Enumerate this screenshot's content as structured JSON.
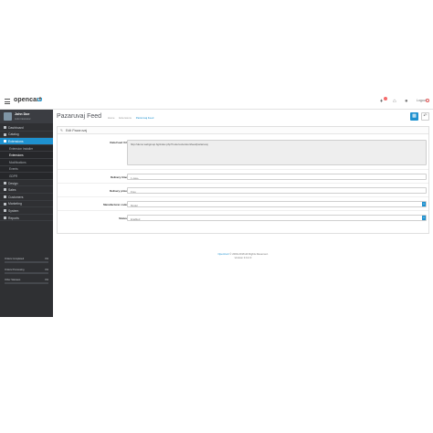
{
  "header": {
    "logo_text": "opencart",
    "logout_label": "Logout",
    "icons": [
      "menu-icon",
      "bell-icon",
      "home-icon",
      "help-icon",
      "logout-icon"
    ]
  },
  "sidebar": {
    "user_name": "John Doe",
    "user_role": "Administrator",
    "items": [
      {
        "label": "Dashboard",
        "icon": "dashboard-icon"
      },
      {
        "label": "Catalog",
        "icon": "tag-icon"
      },
      {
        "label": "Extensions",
        "icon": "puzzle-icon",
        "active": true
      },
      {
        "label": "Extension Installer",
        "sub": true
      },
      {
        "label": "Extensions",
        "sub": true,
        "current": true
      },
      {
        "label": "Modifications",
        "sub": true
      },
      {
        "label": "Events",
        "sub": true
      },
      {
        "label": "GDPR",
        "sub": true
      },
      {
        "label": "Design",
        "icon": "desktop-icon"
      },
      {
        "label": "Sales",
        "icon": "cart-icon"
      },
      {
        "label": "Customers",
        "icon": "user-icon"
      },
      {
        "label": "Marketing",
        "icon": "share-icon"
      },
      {
        "label": "System",
        "icon": "gear-icon"
      },
      {
        "label": "Reports",
        "icon": "chart-icon"
      }
    ],
    "stats": [
      {
        "label": "Orders Completed",
        "value": "0%",
        "fraction": 0
      },
      {
        "label": "Orders Processing",
        "value": "0%",
        "fraction": 0
      },
      {
        "label": "Other Statuses",
        "value": "0%",
        "fraction": 0
      }
    ]
  },
  "main": {
    "title": "Pazaruvaj Feed",
    "breadcrumb": [
      "Home",
      "Extensions",
      "Pazaruvaj Feed"
    ],
    "panel_title": "Edit Pazaruvaj",
    "fields": {
      "feed_url": {
        "label": "Data Feed Url",
        "value": "http://demo.webgroup.bg/index.php?route=extension/feed/pazaruvaj"
      },
      "delivery_time": {
        "label": "Delivery time",
        "value": "1 день"
      },
      "delivery_price": {
        "label": "Delivery price",
        "value": "Free"
      },
      "manufacturer": {
        "label": "Manufacturer code",
        "value": "Model"
      },
      "status": {
        "label": "Status",
        "value": "Enabled"
      }
    },
    "footer_link": "OpenCart",
    "footer_text": "© 2009-2018 All Rights Reserved.",
    "footer_version": "Version 3.0.2.0"
  },
  "colors": {
    "accent": "#1e91cf",
    "sidebar_bg": "#2f3033"
  }
}
